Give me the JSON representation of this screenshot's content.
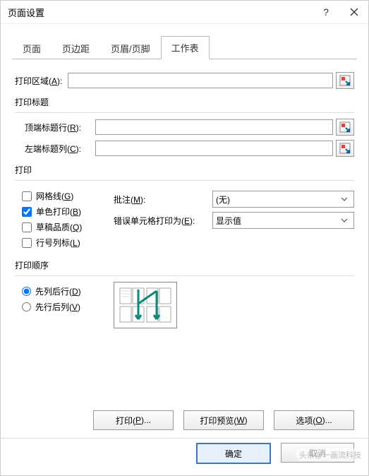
{
  "window": {
    "title": "页面设置"
  },
  "tabs": {
    "t0": "页面",
    "t1": "页边距",
    "t2": "页眉/页脚",
    "t3": "工作表"
  },
  "area": {
    "label_pre": "打印区域(",
    "label_u": "A",
    "label_post": "):",
    "value": ""
  },
  "titles": {
    "heading": "打印标题",
    "top_pre": "顶端标题行(",
    "top_u": "R",
    "top_post": "):",
    "top_value": "",
    "left_pre": "左端标题列(",
    "left_u": "C",
    "left_post": "):",
    "left_value": ""
  },
  "print": {
    "heading": "打印",
    "grid_pre": "网格线(",
    "grid_u": "G",
    "grid_post": ")",
    "bw_pre": "单色打印(",
    "bw_u": "B",
    "bw_post": ")",
    "draft_pre": "草稿品质(",
    "draft_u": "Q",
    "draft_post": ")",
    "rc_pre": "行号列标(",
    "rc_u": "L",
    "rc_post": ")",
    "comments_pre": "批注(",
    "comments_u": "M",
    "comments_post": "):",
    "comments_val": "(无)",
    "errors_pre": "错误单元格打印为(",
    "errors_u": "E",
    "errors_post": "):",
    "errors_val": "显示值"
  },
  "order": {
    "heading": "打印顺序",
    "down_pre": "先列后行(",
    "down_u": "D",
    "down_post": ")",
    "over_pre": "先行后列(",
    "over_u": "V",
    "over_post": ")"
  },
  "buttons": {
    "print_pre": "打印(",
    "print_u": "P",
    "print_post": ")...",
    "preview_pre": "打印预览(",
    "preview_u": "W",
    "preview_post": ")",
    "options_pre": "选项(",
    "options_u": "O",
    "options_post": ")...",
    "ok": "确定",
    "cancel": "取消"
  },
  "watermark": "头条@一画流科技"
}
